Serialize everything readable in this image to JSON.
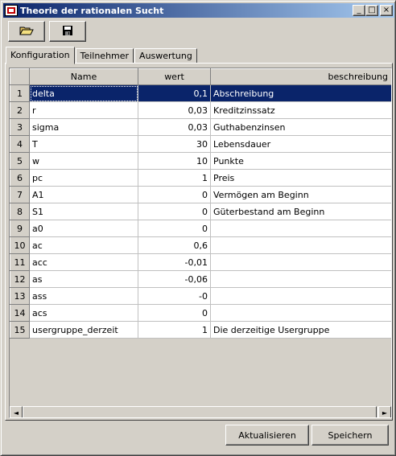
{
  "window": {
    "title": "Theorie der rationalen Sucht",
    "controls": {
      "minimize": "_",
      "maximize": "□",
      "close": "×"
    }
  },
  "toolbar": {
    "open_icon": "open-folder-icon",
    "save_icon": "save-disk-icon"
  },
  "tabs": [
    {
      "label": "Konfiguration",
      "active": true
    },
    {
      "label": "Teilnehmer",
      "active": false
    },
    {
      "label": "Auswertung",
      "active": false
    }
  ],
  "table": {
    "columns": [
      "",
      "Name",
      "wert",
      "beschreibung"
    ],
    "selected_row": 1,
    "rows": [
      {
        "num": "1",
        "name": "delta",
        "wert": "0,1",
        "desc": "Abschreibung"
      },
      {
        "num": "2",
        "name": "r",
        "wert": "0,03",
        "desc": "Kreditzinssatz"
      },
      {
        "num": "3",
        "name": "sigma",
        "wert": "0,03",
        "desc": "Guthabenzinsen"
      },
      {
        "num": "4",
        "name": "T",
        "wert": "30",
        "desc": "Lebensdauer"
      },
      {
        "num": "5",
        "name": "w",
        "wert": "10",
        "desc": "Punkte"
      },
      {
        "num": "6",
        "name": "pc",
        "wert": "1",
        "desc": "Preis"
      },
      {
        "num": "7",
        "name": "A1",
        "wert": "0",
        "desc": "Vermögen am Beginn"
      },
      {
        "num": "8",
        "name": "S1",
        "wert": "0",
        "desc": "Güterbestand am Beginn"
      },
      {
        "num": "9",
        "name": "a0",
        "wert": "0",
        "desc": ""
      },
      {
        "num": "10",
        "name": "ac",
        "wert": "0,6",
        "desc": ""
      },
      {
        "num": "11",
        "name": "acc",
        "wert": "-0,01",
        "desc": ""
      },
      {
        "num": "12",
        "name": "as",
        "wert": "-0,06",
        "desc": ""
      },
      {
        "num": "13",
        "name": "ass",
        "wert": "-0",
        "desc": ""
      },
      {
        "num": "14",
        "name": "acs",
        "wert": "0",
        "desc": ""
      },
      {
        "num": "15",
        "name": "usergruppe_derzeit",
        "wert": "1",
        "desc": "Die derzeitige Usergruppe"
      }
    ]
  },
  "scrollbar": {
    "left_arrow": "◄",
    "right_arrow": "►"
  },
  "buttons": {
    "refresh": "Aktualisieren",
    "save": "Speichern"
  },
  "colors": {
    "selection": "#0a246a",
    "title_gradient_start": "#0a246a",
    "title_gradient_end": "#a6caf0",
    "face": "#d4d0c8"
  }
}
